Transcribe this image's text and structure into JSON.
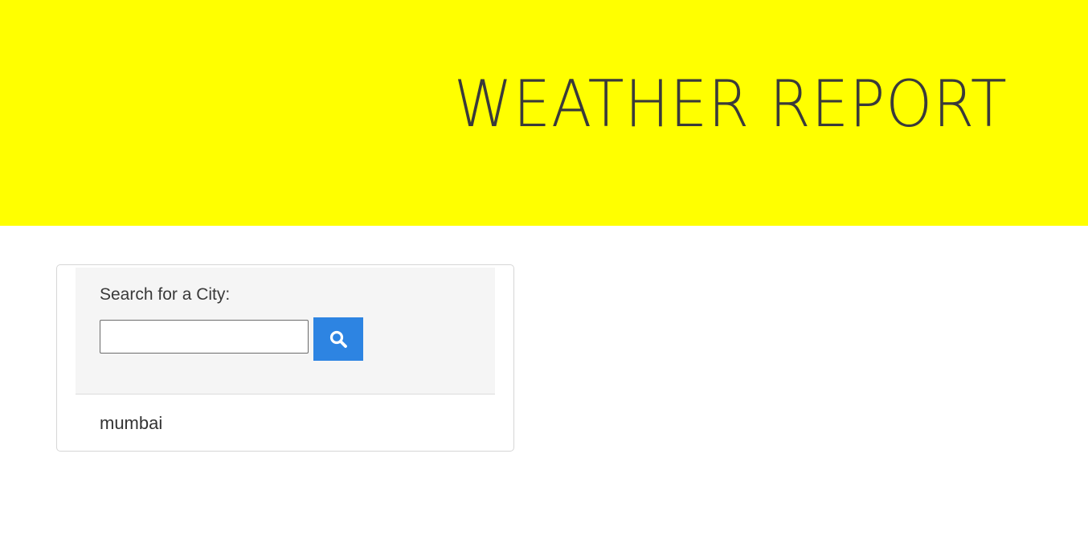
{
  "header": {
    "title": "WEATHER REPORT",
    "background_color": "#ffff00"
  },
  "search": {
    "label": "Search for a City:",
    "input_value": "",
    "placeholder": "",
    "button_icon": "search-icon",
    "button_color": "#2d84e2"
  },
  "results": {
    "items": [
      {
        "label": "mumbai"
      }
    ]
  }
}
